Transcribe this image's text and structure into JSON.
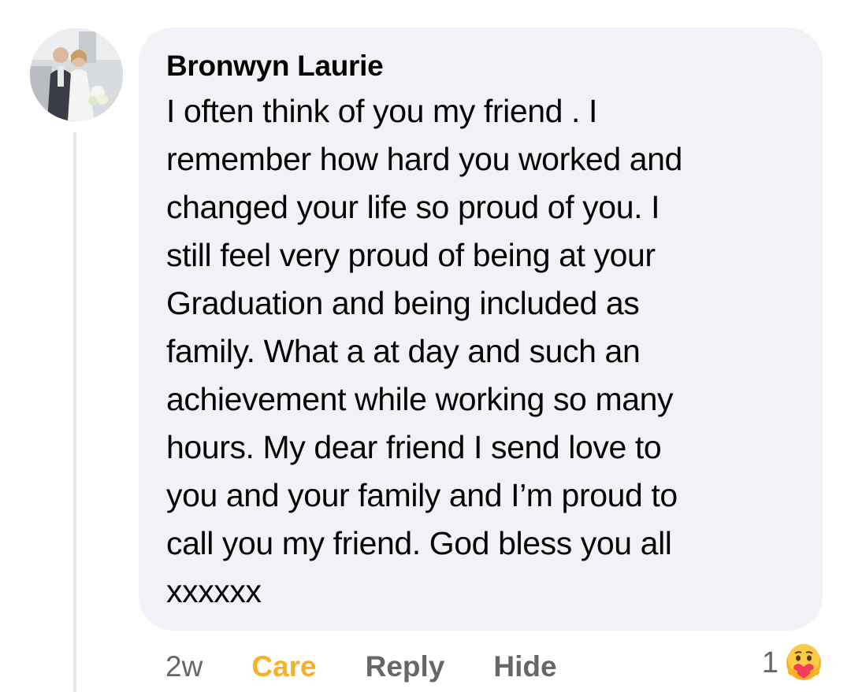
{
  "comment": {
    "author": "Bronwyn Laurie",
    "lines": [
      "I often think of you my friend . I",
      "remember how hard you worked and",
      "changed your life so proud of you. I",
      "still feel very proud of being at your",
      "Graduation and being included as",
      "family. What a at day and such an",
      "achievement while working so many",
      "hours. My dear friend I send love to",
      "you and your family and I’m proud to",
      "call you my friend. God bless you all",
      "xxxxxx"
    ],
    "timestamp": "2w",
    "actions": {
      "care": "Care",
      "reply": "Reply",
      "hide": "Hide"
    },
    "reaction": {
      "count": "1",
      "icon": "care-emoji-icon"
    }
  },
  "colors": {
    "bubble": "#f0f2f5",
    "text": "#050505",
    "muted": "#65676b",
    "care": "#f7b125"
  }
}
